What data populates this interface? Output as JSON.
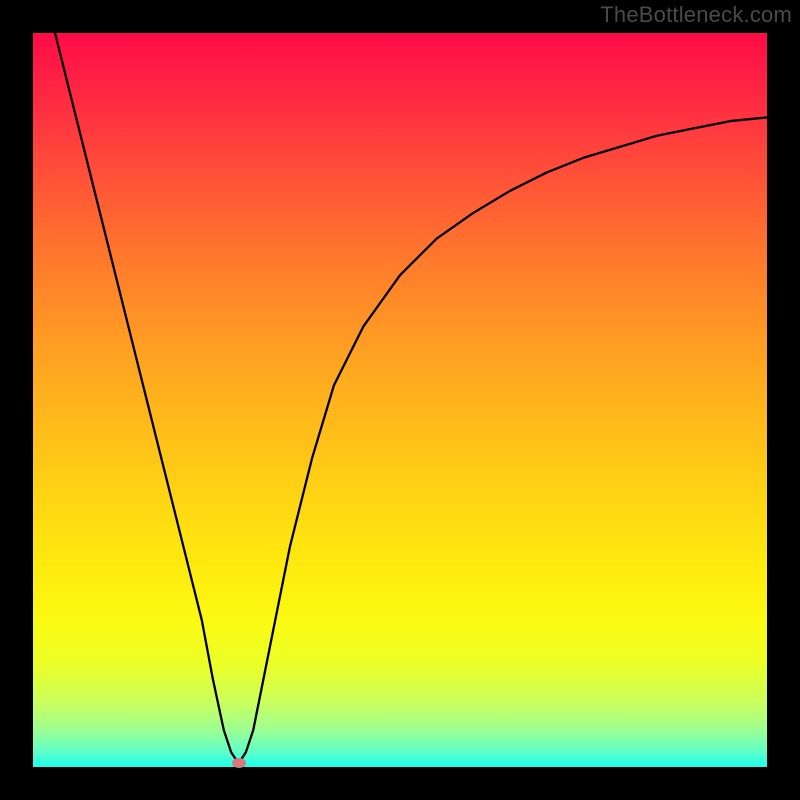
{
  "watermark": "TheBottleneck.com",
  "chart_data": {
    "type": "line",
    "title": "",
    "xlabel": "",
    "ylabel": "",
    "xlim": [
      0,
      100
    ],
    "ylim": [
      0,
      100
    ],
    "grid": false,
    "legend": false,
    "series": [
      {
        "name": "curve",
        "x": [
          3,
          5,
          7,
          9,
          11,
          13,
          15,
          17,
          19,
          21,
          23,
          24.5,
          26,
          27,
          28,
          29,
          30,
          31,
          33,
          35,
          38,
          41,
          45,
          50,
          55,
          60,
          65,
          70,
          75,
          80,
          85,
          90,
          95,
          100
        ],
        "values": [
          100,
          92,
          84,
          76,
          68,
          60,
          52,
          44,
          36,
          28,
          20,
          12,
          5,
          2,
          0.5,
          2,
          5,
          10,
          20,
          30,
          42,
          52,
          60,
          67,
          72,
          75.5,
          78.5,
          81,
          83,
          84.5,
          86,
          87,
          88,
          88.5
        ]
      }
    ],
    "marker": {
      "x": 28,
      "y": 0.5
    },
    "colors": {
      "curve": "#000000",
      "marker": "#d77a7e",
      "gradient_top": "#ff0b47",
      "gradient_bottom": "#1cffec",
      "frame": "#000000"
    }
  }
}
